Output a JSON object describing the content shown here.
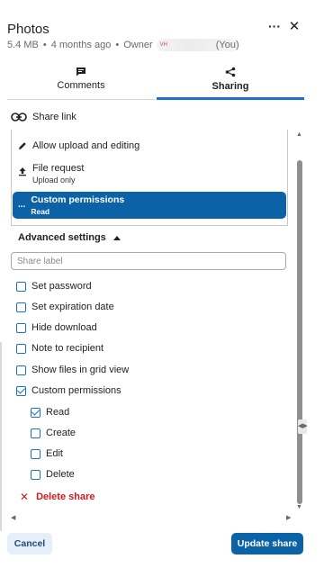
{
  "header": {
    "title": "Photos",
    "size": "5.4 MB",
    "modified": "4 months ago",
    "owner_label": "Owner",
    "owner_initials": "VH",
    "owner_you": "(You)"
  },
  "tabs": [
    {
      "label": "Comments",
      "icon": "comment-icon",
      "active": false
    },
    {
      "label": "Sharing",
      "icon": "share-icon",
      "active": true
    }
  ],
  "share_link_label": "Share link",
  "permissions": {
    "upload_label": "Allow upload and editing",
    "file_request_label": "File request",
    "file_request_sub": "Upload only",
    "custom_label": "Custom permissions",
    "custom_sub": "Read",
    "custom_dots": "...",
    "selected": "Custom permissions"
  },
  "advanced": {
    "title": "Advanced settings",
    "share_label_placeholder": "Share label",
    "share_label_value": "",
    "options": [
      {
        "label": "Set password",
        "checked": false
      },
      {
        "label": "Set expiration date",
        "checked": false
      },
      {
        "label": "Hide download",
        "checked": false
      },
      {
        "label": "Note to recipient",
        "checked": false
      },
      {
        "label": "Show files in grid view",
        "checked": false
      },
      {
        "label": "Custom permissions",
        "checked": true
      }
    ],
    "sub_options": [
      {
        "label": "Read",
        "checked": true
      },
      {
        "label": "Create",
        "checked": false
      },
      {
        "label": "Edit",
        "checked": false
      },
      {
        "label": "Delete",
        "checked": false
      }
    ],
    "delete_label": "Delete share"
  },
  "footer": {
    "cancel_label": "Cancel",
    "update_label": "Update share"
  },
  "colors": {
    "accent": "#0c62a6",
    "checkbox": "#1a73c5",
    "danger": "#d8171d"
  },
  "icons": {
    "more": "more-horizontal-icon",
    "close": "close-icon",
    "link": "link-icon",
    "pencil": "pencil-icon",
    "upload": "upload-icon",
    "chevron": "chevron-up-icon",
    "delete": "close-x-icon"
  }
}
